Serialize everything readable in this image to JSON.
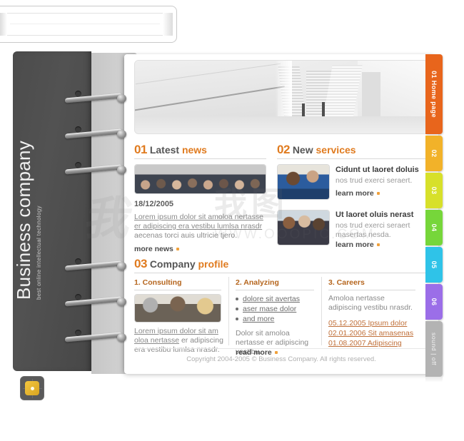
{
  "brand": {
    "title": "Business company",
    "tagline": "best online intellectual technology",
    "logo_icon": "target-square-icon"
  },
  "hero": {
    "image_alt": "building-interior-escalator-photo"
  },
  "sections": {
    "latest_news": {
      "number": "01",
      "title_primary": "Latest",
      "title_accent": "news",
      "thumb_alt": "business-group-photo",
      "date": "18/12/2005",
      "link_text": "Lorem ipsum dolor sit amoloa nertasse er adipiscing era vestibu lumlsa nrasdr",
      "body_text": "aecenas torci auis ultricie tjero.",
      "more_label": "more news"
    },
    "new_services": {
      "number": "02",
      "title_primary": "New",
      "title_accent": "services",
      "items": [
        {
          "thumb_alt": "two-men-at-laptop-photo",
          "title": "Cidunt ut laoret doluis",
          "text": "nos trud exerci seraert.",
          "link_label": "learn more"
        },
        {
          "thumb_alt": "three-businessmen-photo",
          "title": "Ut laoret oluis nerast",
          "text": "nos trud exerci seraert masertas nesda.",
          "link_label": "learn more"
        }
      ]
    },
    "company_profile": {
      "number": "03",
      "title_primary": "Company",
      "title_accent": "profile",
      "columns": [
        {
          "heading": "1. Consulting",
          "thumb_alt": "meeting-handshake-photo",
          "link_text": "Lorem ipsum dolor sit am oloa nertasse",
          "body_text": "er adipiscing era vestibu lumlsa nrasdr."
        },
        {
          "heading": "2. Analyzing",
          "bullets": [
            "dolore sit avertas",
            "aser mase dolor",
            "and more"
          ],
          "body_text": "Dolor sit amoloa nertasse er adipiscing vestibu.",
          "more_label": "read more"
        },
        {
          "heading": "3. Careers",
          "body_text": "Amoloa nertasse adipiscing vestibu nrasdr.",
          "links": [
            "05.12.2005 Ipsum dolor",
            "02.01.2006 Sit amasenas",
            "01.08.2007 Adipiscing"
          ]
        }
      ]
    }
  },
  "footer": {
    "copyright": "Copyright 2004-2005 © Business Company. All rights reserved."
  },
  "tabs": [
    {
      "number": "01",
      "label": "01  Home page",
      "color": "#e8651c"
    },
    {
      "number": "02",
      "label": "02",
      "color": "#f2b229"
    },
    {
      "number": "03",
      "label": "03",
      "color": "#d7e02a"
    },
    {
      "number": "04",
      "label": "04",
      "color": "#76d63a"
    },
    {
      "number": "05",
      "label": "05",
      "color": "#2fc3e8"
    },
    {
      "number": "06",
      "label": "06",
      "color": "#9b6ee8"
    },
    {
      "number": "sound",
      "label": "sound | off",
      "color": "#b3b3b3"
    }
  ],
  "watermark": {
    "line1": "我图",
    "line2": "WWW.OOOPIC.COM"
  },
  "colors": {
    "accent": "#e07b1f",
    "link": "#c0703a",
    "text": "#555555"
  }
}
